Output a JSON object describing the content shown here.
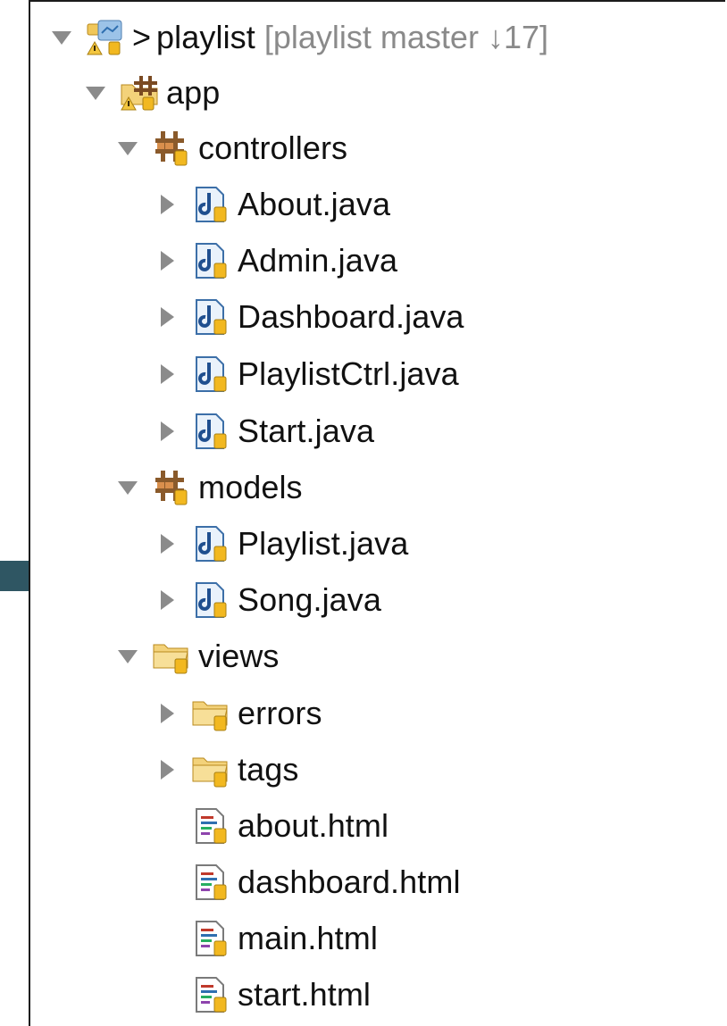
{
  "tree": {
    "root": {
      "prefix": ">",
      "label": "playlist",
      "decoration": "[playlist master ↓17]",
      "icon": "project-icon"
    },
    "nodes": [
      {
        "label": "app",
        "icon": "source-folder-icon",
        "expanded": true
      },
      {
        "label": "controllers",
        "icon": "package-icon",
        "expanded": true
      },
      {
        "label": "About.java",
        "icon": "java-file-icon",
        "expanded": false
      },
      {
        "label": "Admin.java",
        "icon": "java-file-icon",
        "expanded": false
      },
      {
        "label": "Dashboard.java",
        "icon": "java-file-icon",
        "expanded": false
      },
      {
        "label": "PlaylistCtrl.java",
        "icon": "java-file-icon",
        "expanded": false
      },
      {
        "label": "Start.java",
        "icon": "java-file-icon",
        "expanded": false
      },
      {
        "label": "models",
        "icon": "package-icon",
        "expanded": true
      },
      {
        "label": "Playlist.java",
        "icon": "java-file-icon",
        "expanded": false
      },
      {
        "label": "Song.java",
        "icon": "java-file-icon",
        "expanded": false
      },
      {
        "label": "views",
        "icon": "folder-icon",
        "expanded": true
      },
      {
        "label": "errors",
        "icon": "folder-icon",
        "expanded": false
      },
      {
        "label": "tags",
        "icon": "folder-icon",
        "expanded": false
      },
      {
        "label": "about.html",
        "icon": "html-file-icon"
      },
      {
        "label": "dashboard.html",
        "icon": "html-file-icon"
      },
      {
        "label": "main.html",
        "icon": "html-file-icon"
      },
      {
        "label": "start.html",
        "icon": "html-file-icon"
      }
    ]
  },
  "colors": {
    "arrow": "#2f5663",
    "twisty": "#8b8b8b",
    "decoration": "#8a8a8a"
  }
}
